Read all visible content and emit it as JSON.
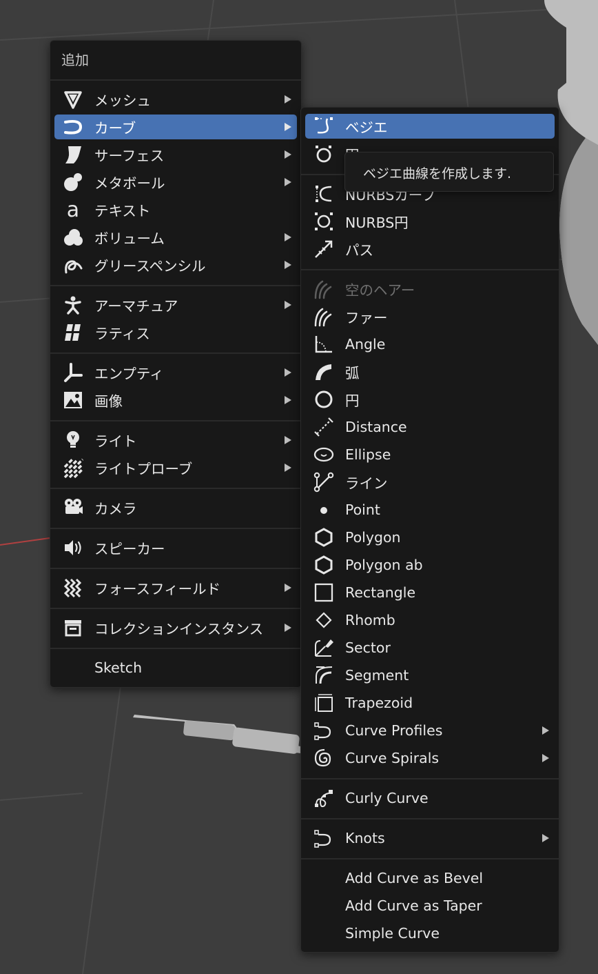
{
  "main_menu": {
    "title": "追加",
    "items": [
      {
        "label": "メッシュ",
        "icon": "mesh-icon",
        "submenu": true
      },
      {
        "label": "カーブ",
        "icon": "curve-icon",
        "submenu": true,
        "active": true
      },
      {
        "label": "サーフェス",
        "icon": "surface-icon",
        "submenu": true
      },
      {
        "label": "メタボール",
        "icon": "metaball-icon",
        "submenu": true
      },
      {
        "label": "テキスト",
        "icon": "text-icon",
        "submenu": false
      },
      {
        "label": "ボリューム",
        "icon": "volume-icon",
        "submenu": true
      },
      {
        "label": "グリースペンシル",
        "icon": "grease-pencil-icon",
        "submenu": true
      },
      {
        "label": "アーマチュア",
        "icon": "armature-icon",
        "submenu": true
      },
      {
        "label": "ラティス",
        "icon": "lattice-icon",
        "submenu": false
      },
      {
        "label": "エンプティ",
        "icon": "empty-icon",
        "submenu": true
      },
      {
        "label": "画像",
        "icon": "image-icon",
        "submenu": true
      },
      {
        "label": "ライト",
        "icon": "light-icon",
        "submenu": true
      },
      {
        "label": "ライトプローブ",
        "icon": "light-probe-icon",
        "submenu": true
      },
      {
        "label": "カメラ",
        "icon": "camera-icon",
        "submenu": false
      },
      {
        "label": "スピーカー",
        "icon": "speaker-icon",
        "submenu": false
      },
      {
        "label": "フォースフィールド",
        "icon": "force-field-icon",
        "submenu": true
      },
      {
        "label": "コレクションインスタンス",
        "icon": "collection-instance-icon",
        "submenu": true
      },
      {
        "label": "Sketch",
        "icon": "",
        "submenu": false
      }
    ]
  },
  "curve_menu": {
    "items": [
      {
        "label": "ベジエ",
        "icon": "bezier-curve-icon",
        "active": true
      },
      {
        "label": "円",
        "icon": "bezier-circle-icon"
      },
      {
        "label": "NURBSカーブ",
        "icon": "nurbs-curve-icon"
      },
      {
        "label": "NURBS円",
        "icon": "nurbs-circle-icon"
      },
      {
        "label": "パス",
        "icon": "path-icon"
      },
      {
        "label": "空のヘアー",
        "icon": "empty-hair-icon",
        "disabled": true
      },
      {
        "label": "ファー",
        "icon": "fur-icon"
      },
      {
        "label": "Angle",
        "icon": "angle-icon"
      },
      {
        "label": "弧",
        "icon": "arc-icon"
      },
      {
        "label": "円",
        "icon": "circle-icon"
      },
      {
        "label": "Distance",
        "icon": "distance-icon"
      },
      {
        "label": "Ellipse",
        "icon": "ellipse-icon"
      },
      {
        "label": "ライン",
        "icon": "line-icon"
      },
      {
        "label": "Point",
        "icon": "point-icon"
      },
      {
        "label": "Polygon",
        "icon": "polygon-icon"
      },
      {
        "label": "Polygon ab",
        "icon": "polygon-ab-icon"
      },
      {
        "label": "Rectangle",
        "icon": "rectangle-icon"
      },
      {
        "label": "Rhomb",
        "icon": "rhomb-icon"
      },
      {
        "label": "Sector",
        "icon": "sector-icon"
      },
      {
        "label": "Segment",
        "icon": "segment-icon"
      },
      {
        "label": "Trapezoid",
        "icon": "trapezoid-icon"
      },
      {
        "label": "Curve Profiles",
        "icon": "curve-profiles-icon",
        "submenu": true
      },
      {
        "label": "Curve Spirals",
        "icon": "curve-spirals-icon",
        "submenu": true
      },
      {
        "label": "Curly Curve",
        "icon": "curly-curve-icon"
      },
      {
        "label": "Knots",
        "icon": "knots-icon",
        "submenu": true
      },
      {
        "label": "Add Curve as Bevel",
        "icon": ""
      },
      {
        "label": "Add Curve as Taper",
        "icon": ""
      },
      {
        "label": "Simple Curve",
        "icon": ""
      }
    ]
  },
  "tooltip": {
    "text": "ベジエ曲線を作成します."
  },
  "colors": {
    "menu_bg": "#181818",
    "highlight": "#4772b3",
    "viewport_bg": "#3d3d3d"
  }
}
